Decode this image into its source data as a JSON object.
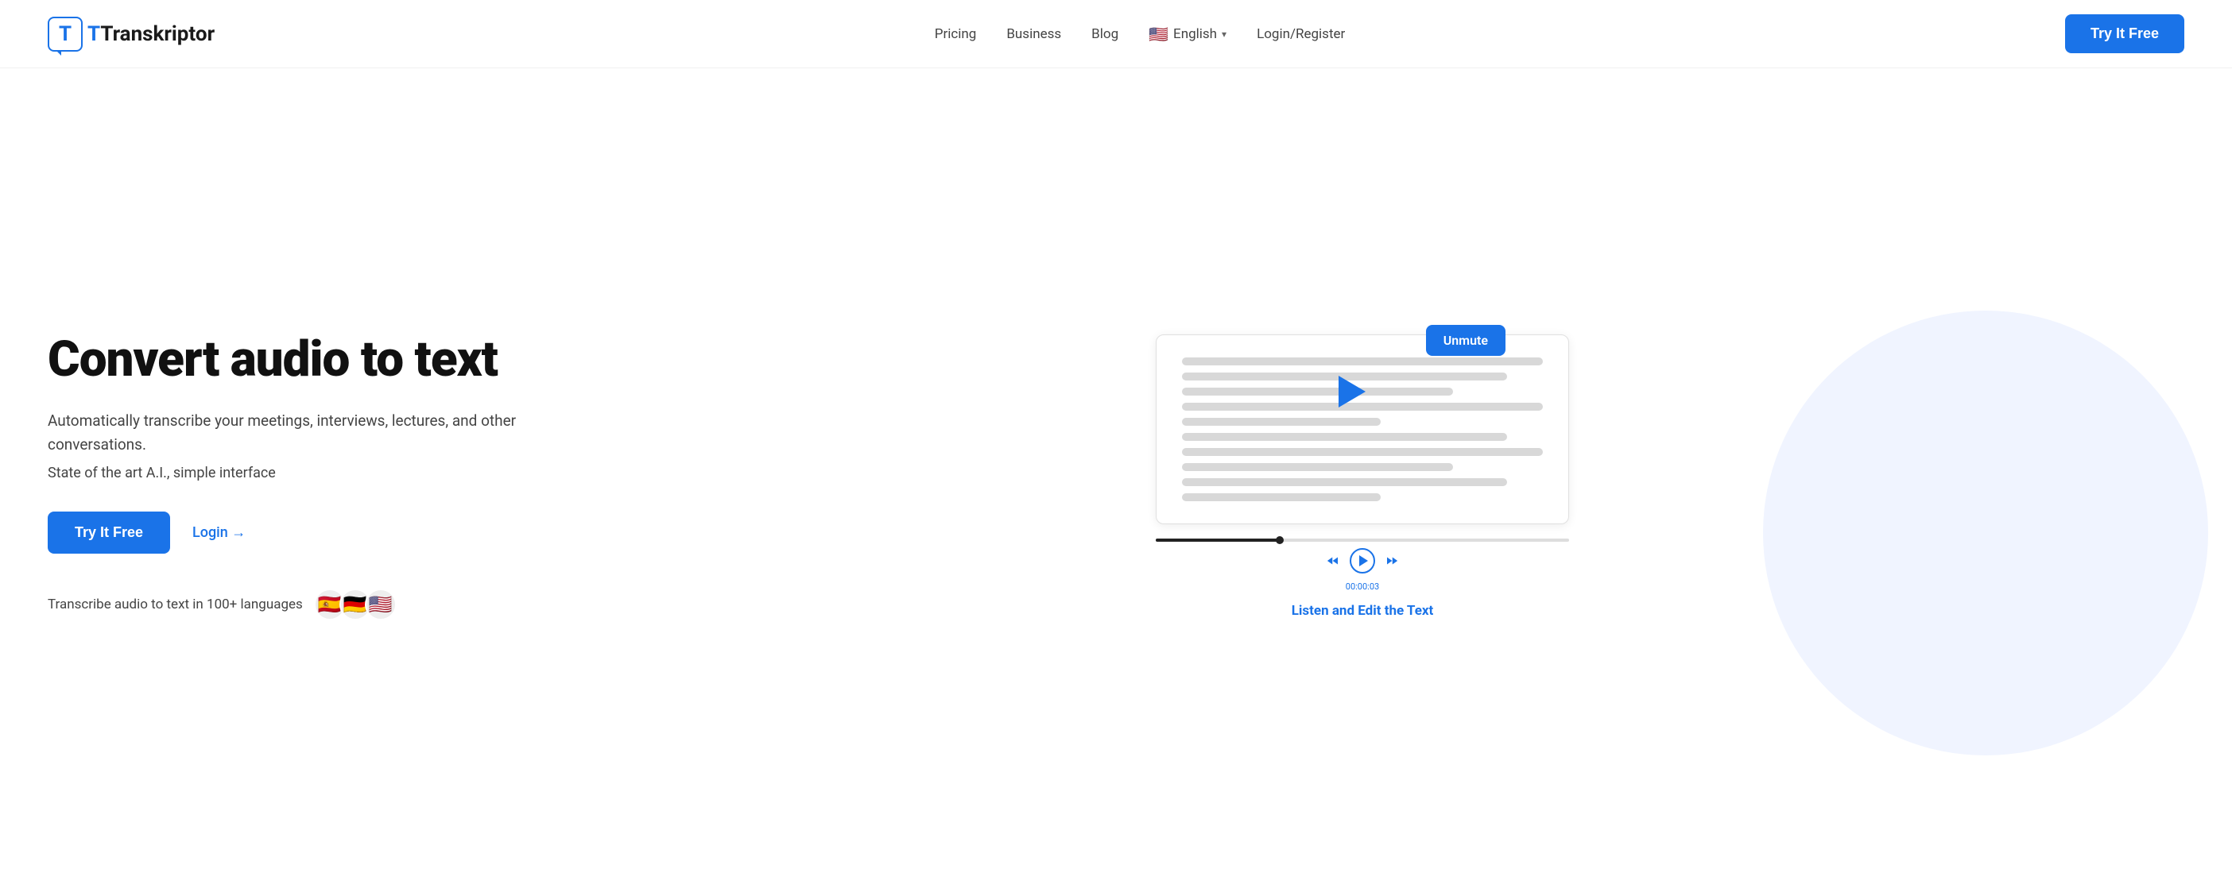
{
  "header": {
    "logo_text": "Transkriptor",
    "logo_letter": "T",
    "nav": {
      "pricing": "Pricing",
      "business": "Business",
      "blog": "Blog",
      "language": "English",
      "login_register": "Login/Register"
    },
    "cta_button": "Try It Free"
  },
  "hero": {
    "title": "Convert audio to text",
    "subtitle": "Automatically transcribe your meetings, interviews, lectures, and other conversations.",
    "tagline": "State of the art A.I., simple interface",
    "cta_try": "Try It Free",
    "cta_login": "Login →",
    "languages_label": "Transcribe audio to text in 100+ languages",
    "flags": [
      "🇪🇸",
      "🇩🇪",
      "🇺🇸"
    ]
  },
  "illustration": {
    "unmute_label": "Unmute",
    "listen_edit_label": "Listen and Edit the Text",
    "time": "00:00:03"
  },
  "colors": {
    "blue": "#1a73e8",
    "text_dark": "#111",
    "text_muted": "#444",
    "line_color": "#d8d8d8",
    "bg_blob": "#f0f4ff"
  }
}
